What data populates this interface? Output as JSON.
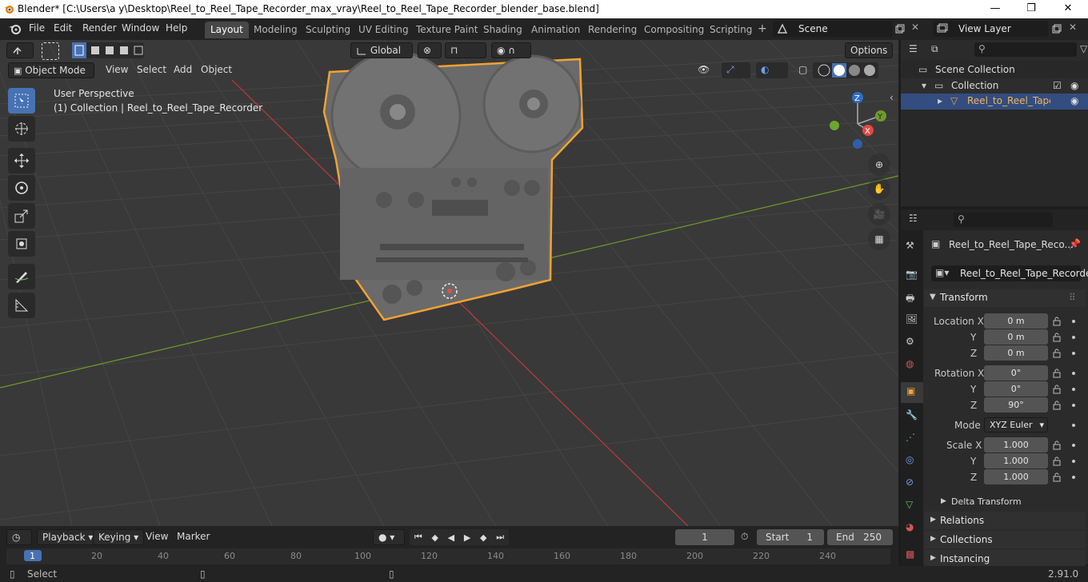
{
  "window": {
    "title": "Blender* [C:\\Users\\a y\\Desktop\\Reel_to_Reel_Tape_Recorder_max_vray\\Reel_to_Reel_Tape_Recorder_blender_base.blend]",
    "minimize": "—",
    "maximize": "❐",
    "close": "✕"
  },
  "menu": [
    "File",
    "Edit",
    "Render",
    "Window",
    "Help"
  ],
  "workspaces": [
    "Layout",
    "Modeling",
    "Sculpting",
    "UV Editing",
    "Texture Paint",
    "Shading",
    "Animation",
    "Rendering",
    "Compositing",
    "Scripting"
  ],
  "active_workspace": "Layout",
  "add_workspace": "+",
  "scene": {
    "label": "Scene"
  },
  "view_layer": {
    "label": "View Layer"
  },
  "viewport": {
    "transform_orientation": "Global",
    "options_label": "Options",
    "mode": "Object Mode",
    "menus": [
      "View",
      "Select",
      "Add",
      "Object"
    ],
    "overlay_title": "User Perspective",
    "overlay_subtitle": "(1) Collection | Reel_to_Reel_Tape_Recorder",
    "gizmo": {
      "z": "Z",
      "y": "Y",
      "x": "X"
    },
    "colors": {
      "x_axis": "#c0393b",
      "y_axis": "#6f9b2a",
      "selection": "#f2a232",
      "active_tool": "#4772b3"
    }
  },
  "outliner": {
    "scene_collection": "Scene Collection",
    "collection": "Collection",
    "object": "Reel_to_Reel_Tape_R"
  },
  "properties": {
    "object_name_header": "Reel_to_Reel_Tape_Reco...",
    "object_name": "Reel_to_Reel_Tape_Recorder",
    "transform_label": "Transform",
    "location_label": "Location X",
    "location": [
      "0 m",
      "0 m",
      "0 m"
    ],
    "rotation_label": "Rotation X",
    "rotation": [
      "0°",
      "0°",
      "90°"
    ],
    "mode_label": "Mode",
    "mode_value": "XYZ Euler",
    "scale_label": "Scale X",
    "scale": [
      "1.000",
      "1.000",
      "1.000"
    ],
    "axis_y": "Y",
    "axis_z": "Z",
    "delta_transform": "Delta Transform",
    "relations": "Relations",
    "collections": "Collections",
    "instancing": "Instancing"
  },
  "timeline": {
    "menus": [
      "Playback",
      "Keying",
      "View",
      "Marker"
    ],
    "current_frame": "1",
    "start_label": "Start",
    "start": "1",
    "end_label": "End",
    "end": "250",
    "ticks": [
      "1",
      "20",
      "40",
      "60",
      "80",
      "100",
      "120",
      "140",
      "160",
      "180",
      "200",
      "220",
      "240"
    ]
  },
  "status": {
    "left": "Select",
    "version": "2.91.0"
  }
}
